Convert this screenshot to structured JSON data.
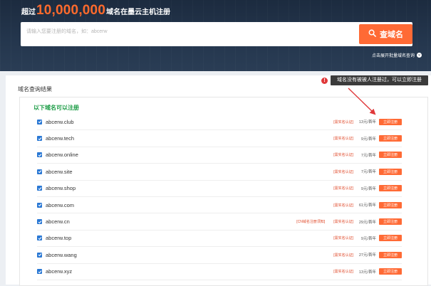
{
  "hero": {
    "title_prefix": "超过",
    "title_number": "10,000,000",
    "title_suffix": "域名在墨云主机注册",
    "search_placeholder": "请输入您要注册的域名，如：abcerw",
    "search_button": "查域名",
    "batch_link": "点击展开批量域名查询"
  },
  "results": {
    "panel_title": "域名查询结果",
    "available_title": "以下域名可以注册",
    "rows": [
      {
        "domain": "abcerw.club",
        "tag": "[需实名认证]",
        "price": "13元/首年",
        "button": "立即注册"
      },
      {
        "domain": "abcerw.tech",
        "tag": "[需实名认证]",
        "price": "9元/首年",
        "button": "立即注册"
      },
      {
        "domain": "abcerw.online",
        "tag": "[需实名认证]",
        "price": "7元/首年",
        "button": "立即注册"
      },
      {
        "domain": "abcerw.site",
        "tag": "[需实名认证]",
        "price": "7元/首年",
        "button": "立即注册"
      },
      {
        "domain": "abcerw.shop",
        "tag": "[需实名认证]",
        "price": "9元/首年",
        "button": "立即注册"
      },
      {
        "domain": "abcerw.com",
        "tag": "[需实名认证]",
        "price": "61元/首年",
        "button": "立即注册"
      },
      {
        "domain": "abcerw.cn",
        "pre_tag": "[CN域名注册须知]",
        "tag": "[需实名认证]",
        "price": "29元/首年",
        "button": "立即注册"
      },
      {
        "domain": "abcerw.top",
        "tag": "[需实名认证]",
        "price": "9元/首年",
        "button": "立即注册"
      },
      {
        "domain": "abcerw.wang",
        "tag": "[需实名认证]",
        "price": "27元/首年",
        "button": "立即注册"
      },
      {
        "domain": "abcerw.xyz",
        "tag": "[需实名认证]",
        "price": "13元/首年",
        "button": "立即注册"
      }
    ]
  },
  "annotation": {
    "tooltip": "域名没有被被人注册过，可以立即注册"
  },
  "colors": {
    "accent": "#ff6a35",
    "hero_bg": "#24364d",
    "available_green": "#1b9c45",
    "checkbox_blue": "#2a78d4",
    "arrow_red": "#e0383a"
  }
}
